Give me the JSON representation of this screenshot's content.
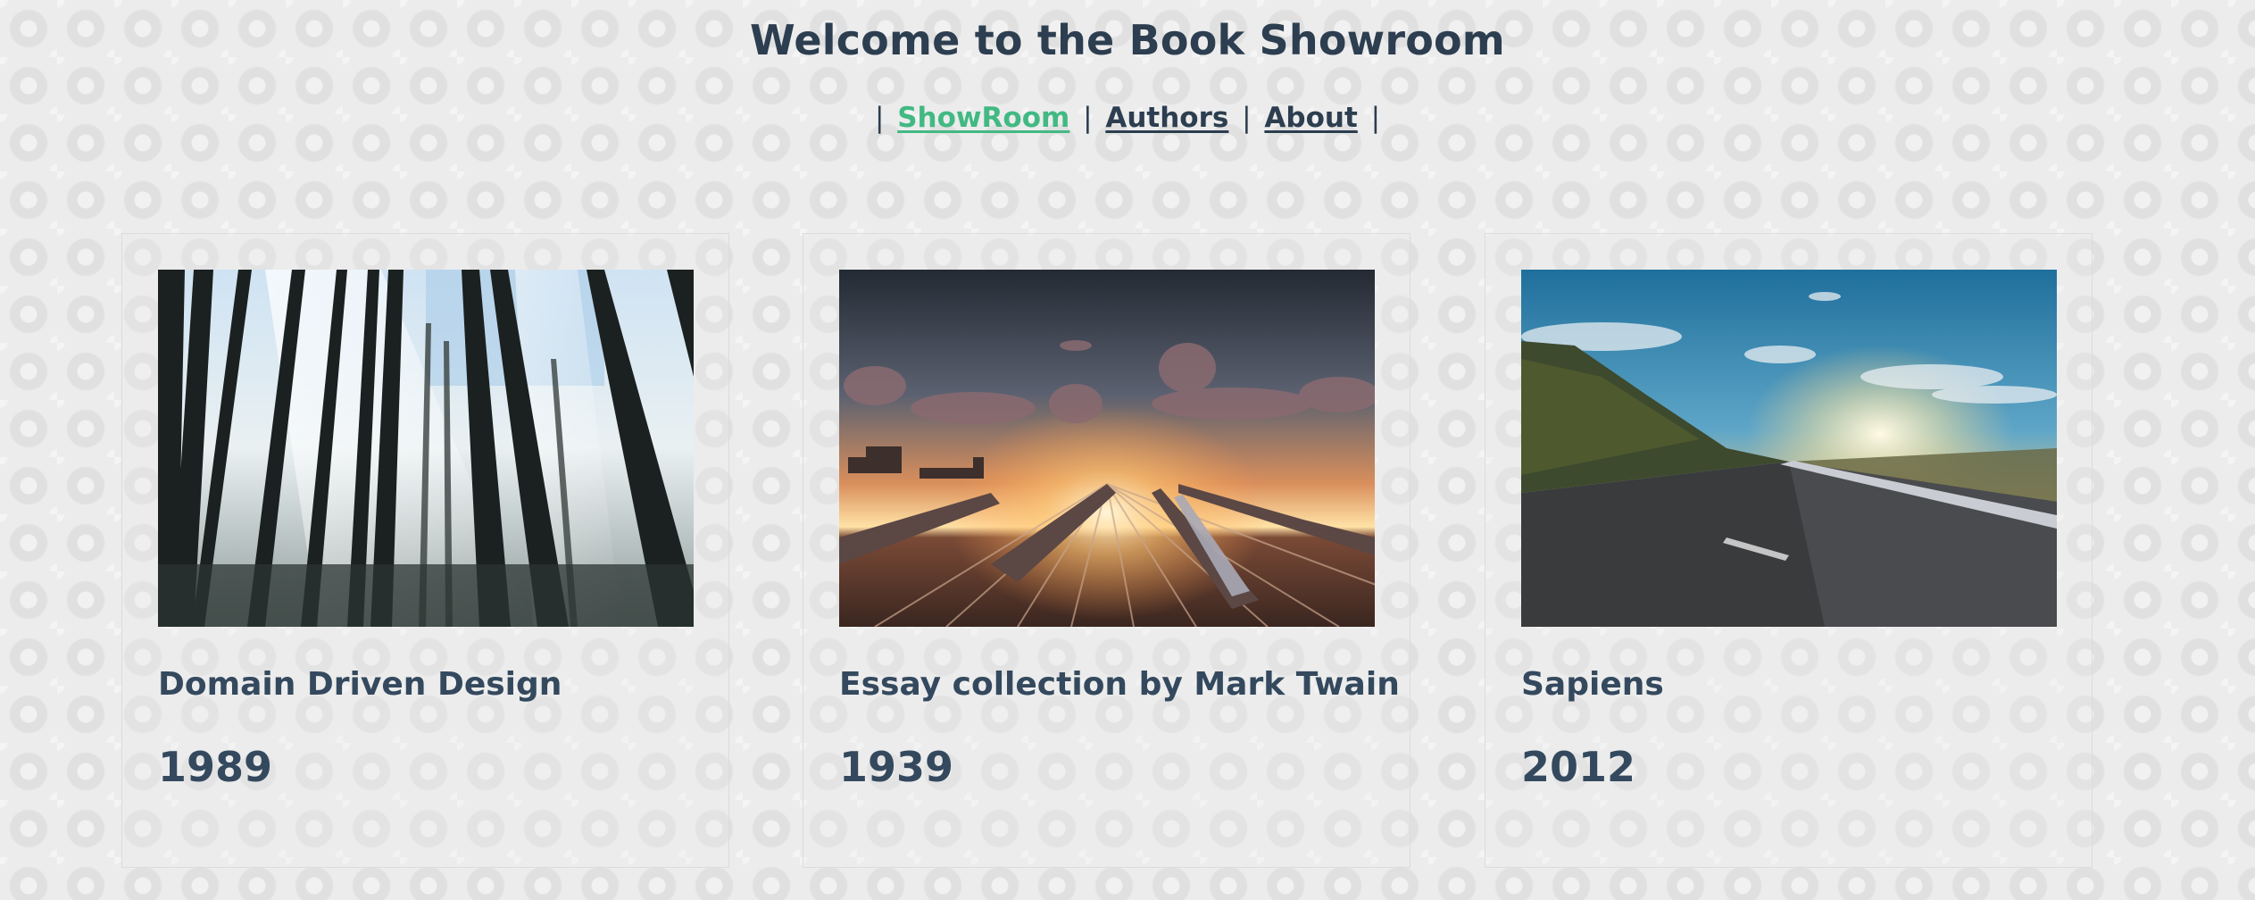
{
  "header": {
    "title": "Welcome to the Book Showroom"
  },
  "nav": {
    "separator": "|",
    "items": [
      {
        "label": "ShowRoom",
        "active": true
      },
      {
        "label": "Authors",
        "active": false
      },
      {
        "label": "About",
        "active": false
      }
    ]
  },
  "colors": {
    "text": "#2c3e50",
    "accent": "#42b983",
    "card_border": "#dcdcdc"
  },
  "books": [
    {
      "title": "Domain Driven Design",
      "year": "1989",
      "image": "forest-photo"
    },
    {
      "title": "Essay collection by Mark Twain",
      "year": "1939",
      "image": "railway-sunset-photo"
    },
    {
      "title": "Sapiens",
      "year": "2012",
      "image": "mountain-road-photo"
    }
  ]
}
